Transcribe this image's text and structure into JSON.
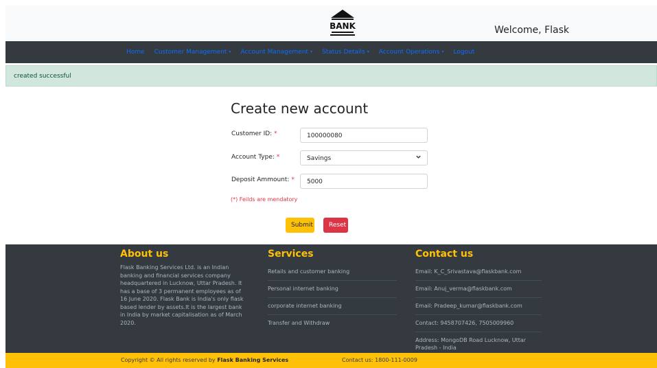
{
  "header": {
    "logo_text": "BANK",
    "welcome": "Welcome, Flask"
  },
  "nav": {
    "items": [
      {
        "label": "Home",
        "dropdown": false
      },
      {
        "label": "Customer Management",
        "dropdown": true
      },
      {
        "label": "Account Management",
        "dropdown": true
      },
      {
        "label": "Status Details",
        "dropdown": true
      },
      {
        "label": "Account Operations",
        "dropdown": true
      },
      {
        "label": "Logout",
        "dropdown": false
      }
    ]
  },
  "alert": {
    "message": "created successful"
  },
  "form": {
    "title": "Create new account",
    "customer_id": {
      "label": "Customer ID:",
      "value": "100000080"
    },
    "account_type": {
      "label": "Account Type:",
      "value": "Savings"
    },
    "deposit": {
      "label": "Deposit Ammount:",
      "value": "5000"
    },
    "required_mark": "*",
    "note": "(*) Feilds are mendatory",
    "submit_label": "Submit",
    "reset_label": "Reset"
  },
  "footer": {
    "about": {
      "heading": "About us",
      "text": "Flask Banking Services Ltd. is an Indian banking and financial services company headquartered in Lucknow, Uttar Pradesh. It has a base of 3 permanent employees as of 16 June 2020. Flask Bank is India's only flask based lender by assets.It is the largest bank in India by market capitalisation as of March 2020."
    },
    "services": {
      "heading": "Services",
      "items": [
        "Retails and customer banking",
        "Personal internet banking",
        "corporate internet banking",
        "Transfer and Withdraw"
      ]
    },
    "contact": {
      "heading": "Contact us",
      "items": [
        "Email: K_C_Srivastava@flaskbank.com",
        "Email: Anuj_verma@flaskbank.com",
        "Email: Pradeep_kumar@flaskbank.com",
        "Contact: 9458707426, 7505009960",
        "Address: MongoDB Road Lucknow, Uttar Pradesh - India"
      ]
    }
  },
  "bottombar": {
    "copyright_prefix": "Copyright © All rights reserved by ",
    "company": "Flask Banking Services",
    "contact": "Contact us: 1800-111-0009"
  },
  "colors": {
    "navbar": "#343a40",
    "link": "#0d6efd",
    "accent": "#ffc107",
    "danger": "#dc3545",
    "alert_bg": "#d1e7dd"
  }
}
